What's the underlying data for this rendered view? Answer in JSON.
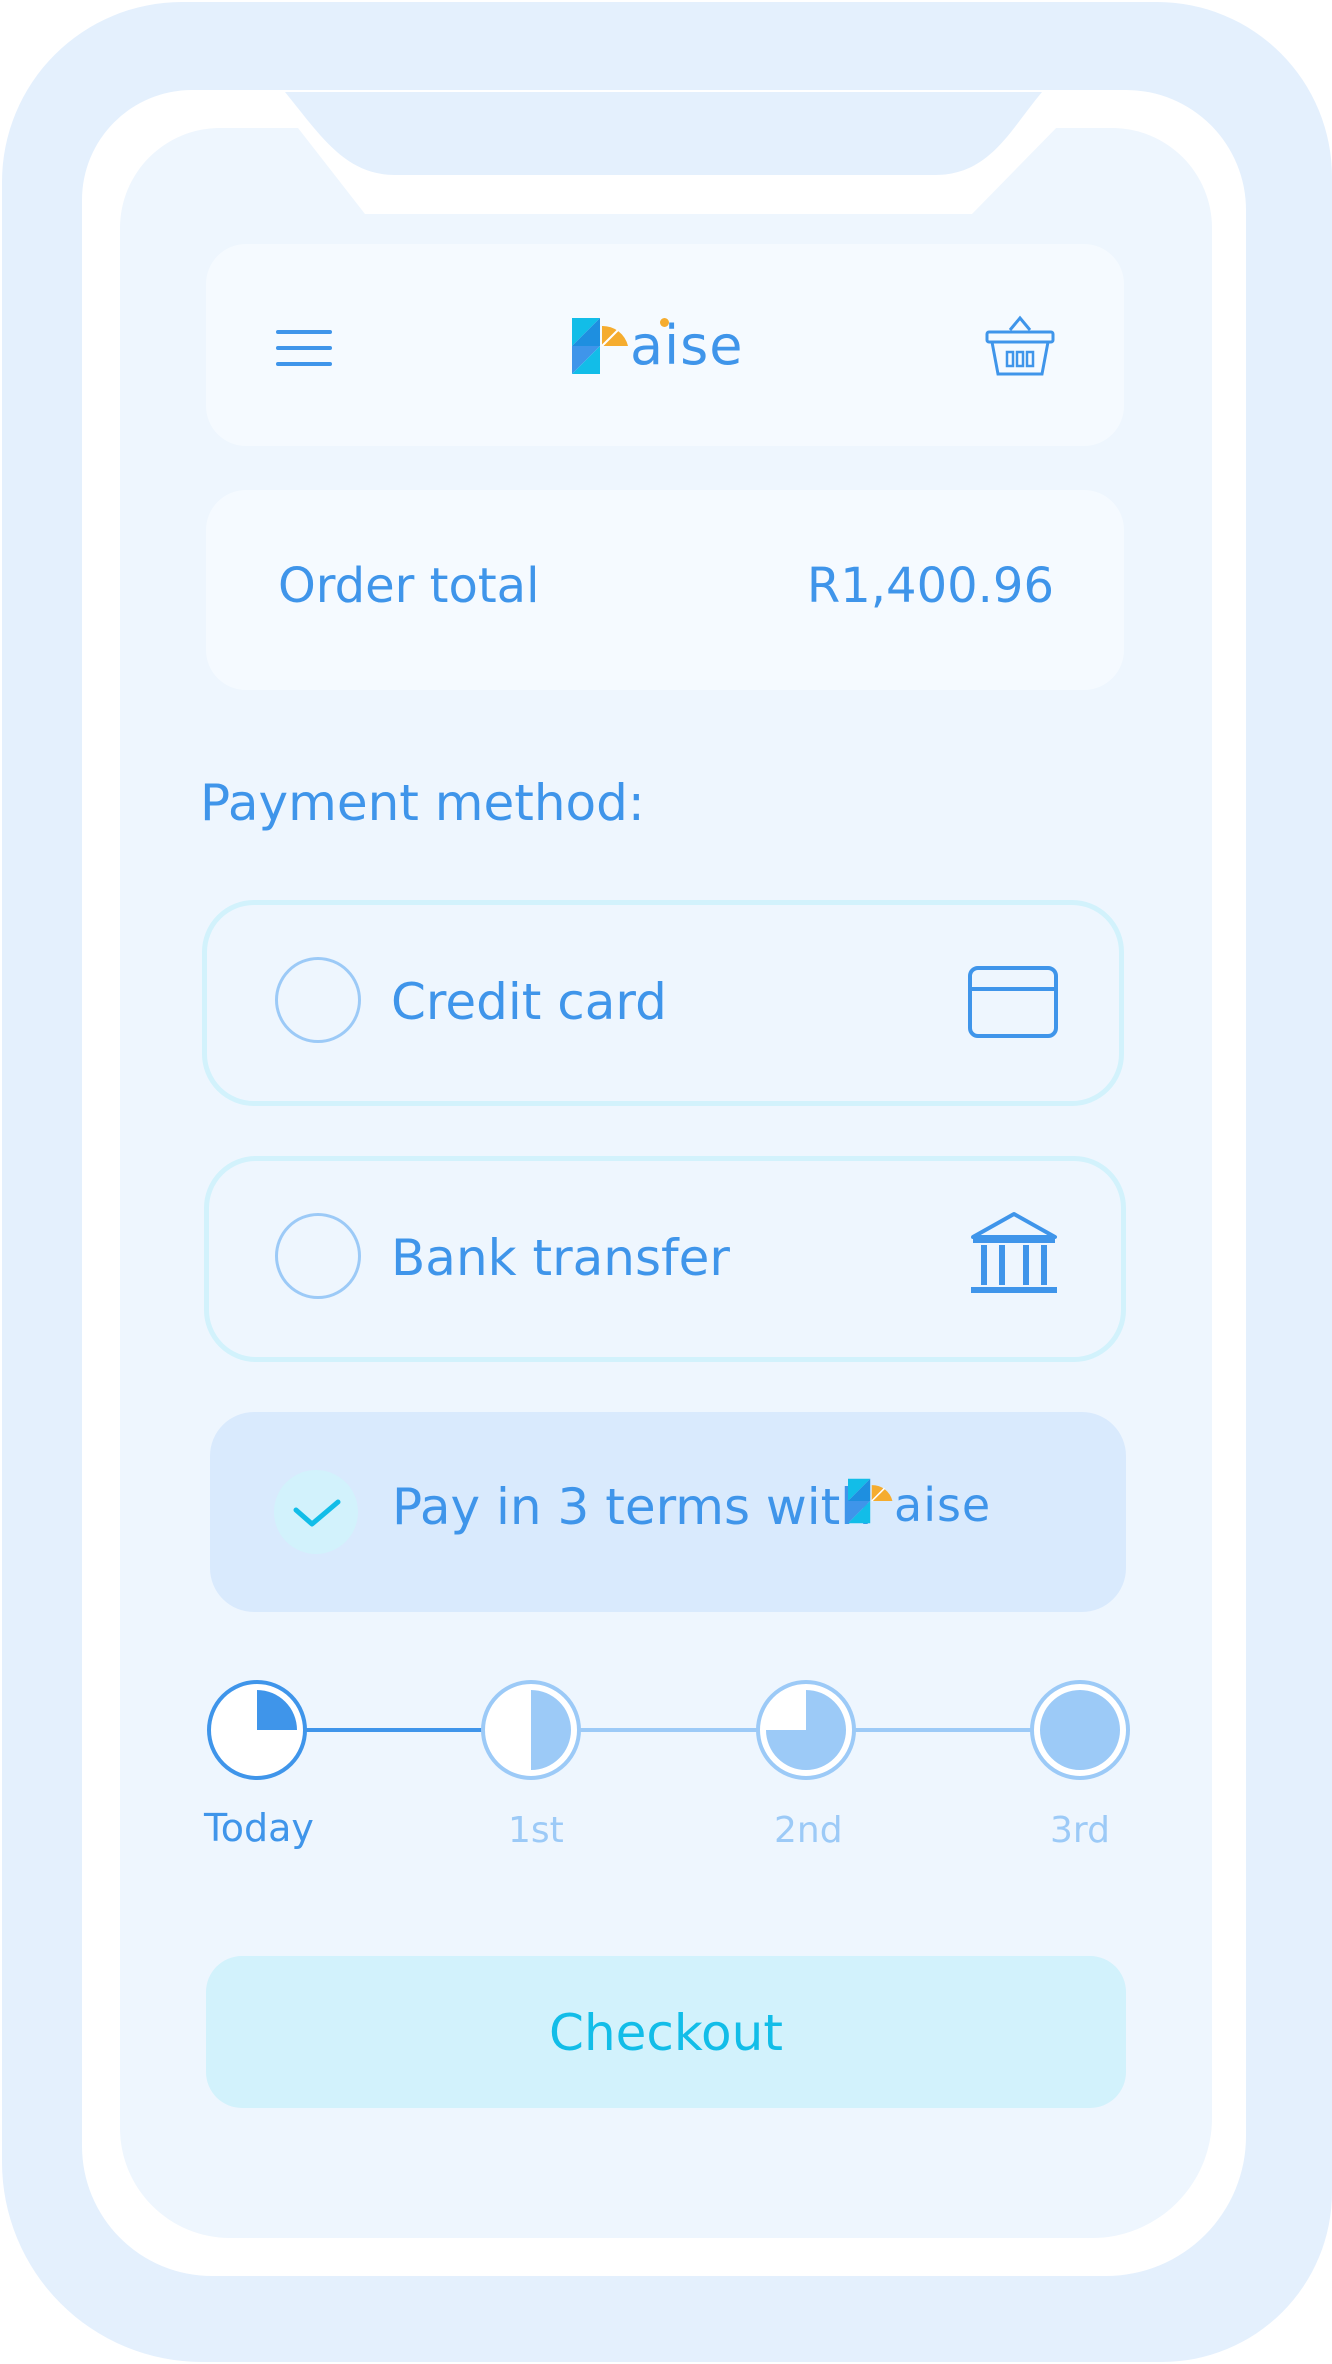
{
  "header": {
    "menu_icon": "hamburger-menu-icon",
    "logo_text": "aise",
    "basket_icon": "shopping-basket-icon"
  },
  "order": {
    "label": "Order total",
    "amount": "R1,400.96"
  },
  "payment": {
    "heading": "Payment method:",
    "options": [
      {
        "label": "Credit card",
        "icon": "credit-card-icon",
        "selected": false
      },
      {
        "label": "Bank transfer",
        "icon": "bank-icon",
        "selected": false
      },
      {
        "label": "Pay in 3 terms with",
        "brand": "aise",
        "icon": "checkmark-icon",
        "selected": true
      }
    ]
  },
  "schedule": {
    "steps": [
      {
        "label": "Today",
        "fraction": 0.25
      },
      {
        "label": "1st",
        "fraction": 0.5
      },
      {
        "label": "2nd",
        "fraction": 0.75
      },
      {
        "label": "3rd",
        "fraction": 1
      }
    ]
  },
  "checkout": {
    "label": "Checkout"
  },
  "colors": {
    "accent": "#3f95ea",
    "accent_light": "#9ccaf7",
    "cyan": "#12bde8",
    "logo_orange": "#f5ac2f",
    "selected_bg": "#d9eafd"
  }
}
